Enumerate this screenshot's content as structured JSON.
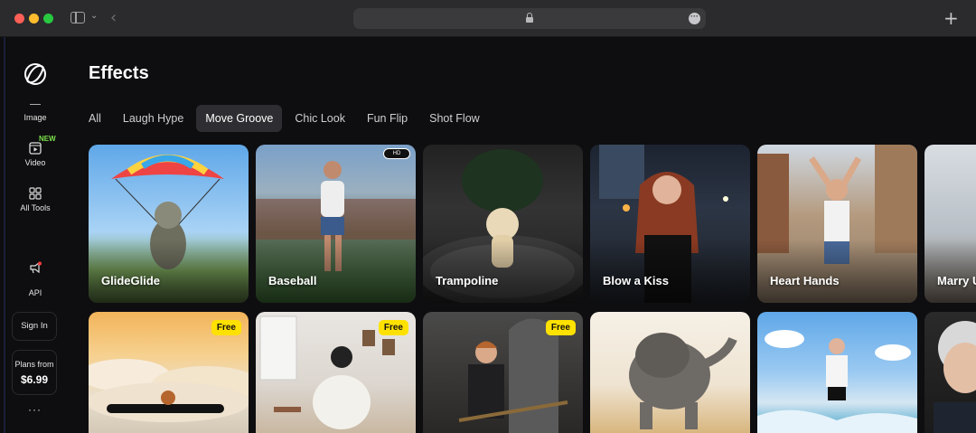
{
  "browser": {
    "url_icon": "lock-icon",
    "menu_icon": "ellipsis-circle-icon",
    "new_tab_label": "+"
  },
  "sidebar": {
    "items": [
      {
        "label": "Image",
        "icon": "image-icon"
      },
      {
        "label": "Video",
        "icon": "video-icon",
        "badge": "NEW"
      },
      {
        "label": "All Tools",
        "icon": "grid-icon"
      },
      {
        "label": "API",
        "icon": "megaphone-icon"
      }
    ],
    "sign_in": "Sign In",
    "plans_label": "Plans from",
    "plans_price": "$6.99",
    "more": "···"
  },
  "main": {
    "title": "Effects",
    "tabs": [
      "All",
      "Laugh Hype",
      "Move Groove",
      "Chic Look",
      "Fun Flip",
      "Shot Flow"
    ],
    "active_tab": "Move Groove",
    "row1": [
      "GlideGlide",
      "Baseball",
      "Trampoline",
      "Blow a Kiss",
      "Heart Hands",
      "Marry U"
    ],
    "row2_badges": [
      "Free",
      "Free",
      "Free"
    ],
    "hd_badge": "HD"
  }
}
